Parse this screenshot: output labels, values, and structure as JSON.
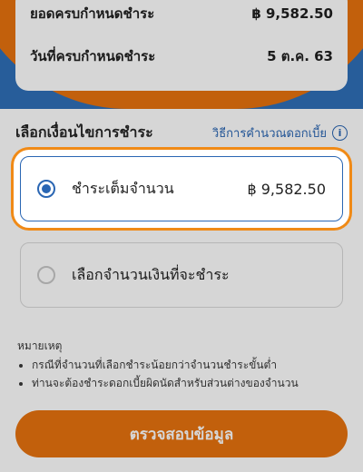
{
  "summary": {
    "total_due_label": "ยอดครบกำหนดชำระ",
    "total_due_value": "฿ 9,582.50",
    "due_date_label": "วันที่ครบกำหนดชำระ",
    "due_date_value": "5 ต.ค. 63"
  },
  "payment_section": {
    "title": "เลือกเงื่อนไขการชำระ",
    "interest_link": "วิธีการคำนวณดอกเบี้ย",
    "info_icon": "i"
  },
  "options": [
    {
      "label": "ชำระเต็มจำนวน",
      "amount": "฿ 9,582.50",
      "selected": true
    },
    {
      "label": "เลือกจำนวนเงินที่จะชำระ",
      "selected": false
    }
  ],
  "notes": {
    "title": "หมายเหตุ",
    "items": [
      "กรณีที่จำนวนที่เลือกชำระน้อยกว่าจำนวนชำระขั้นต่ำ",
      "ท่านจะต้องชำระดอกเบี้ยผิดนัดสำหรับส่วนต่างของจำนวน"
    ]
  },
  "cta": {
    "label": "ตรวจสอบข้อมูล"
  },
  "colors": {
    "accent": "#e8730f",
    "primary_blue": "#2a66b3",
    "header_blue": "#2f6fb8"
  },
  "icons": {
    "info": "info-icon",
    "radio_on": "radio-selected-icon",
    "radio_off": "radio-unselected-icon"
  }
}
